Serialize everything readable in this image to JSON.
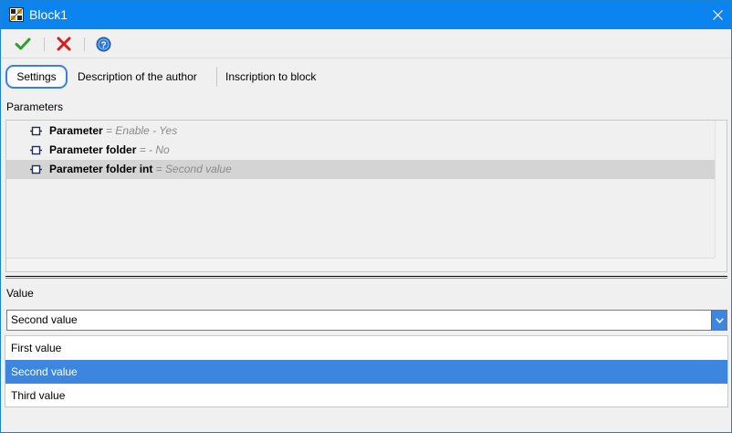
{
  "window": {
    "title": "Block1"
  },
  "toolbar": {
    "ok_icon": "check-icon",
    "cancel_icon": "cross-icon",
    "help_icon": "help-icon"
  },
  "tabs": [
    {
      "label": "Settings"
    },
    {
      "label": "Description of the author"
    },
    {
      "label": "Inscription to block"
    }
  ],
  "parameters": {
    "label": "Parameters",
    "rows": [
      {
        "name": "Parameter",
        "value": " = Enable - Yes"
      },
      {
        "name": "Parameter folder",
        "value": " =  - No"
      },
      {
        "name": "Parameter folder int",
        "value": " = Second value"
      }
    ]
  },
  "value": {
    "label": "Value",
    "selected": "Second value",
    "options": [
      "First value",
      "Second value",
      "Third value"
    ]
  },
  "colors": {
    "titlebar": "#0b84f0",
    "accent": "#3d86df",
    "ok_green": "#2f9e2f",
    "cancel_red": "#d81b1b"
  }
}
